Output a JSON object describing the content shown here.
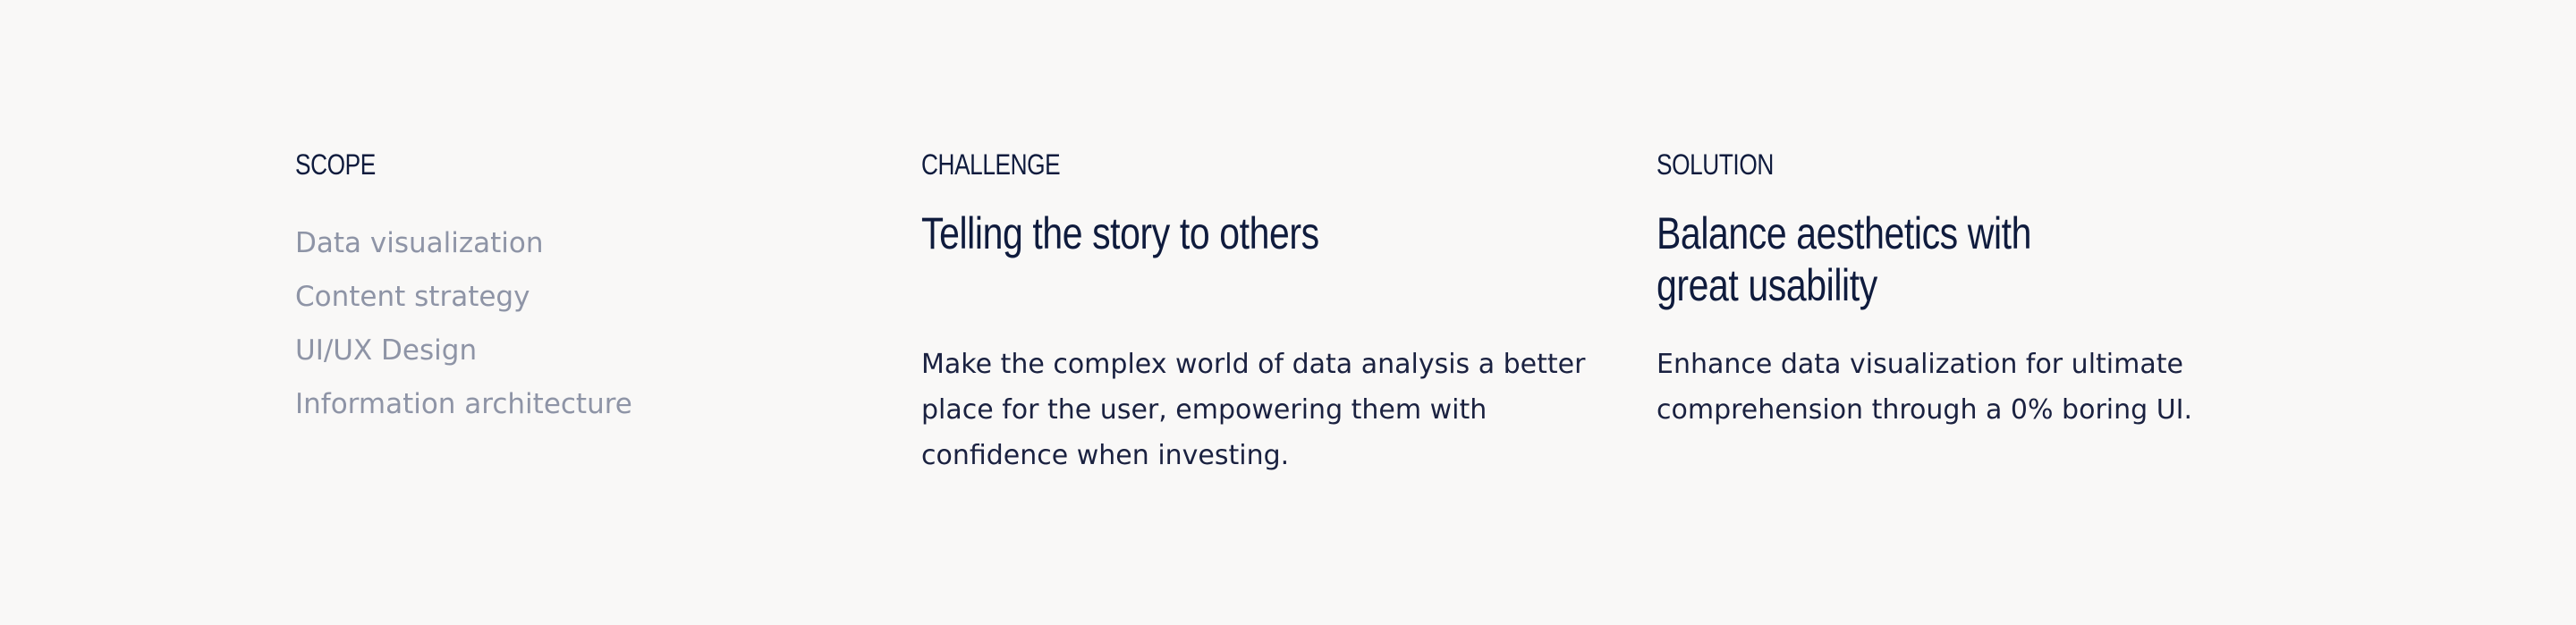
{
  "scope": {
    "label": "SCOPE",
    "items": [
      "Data visualization",
      "Content strategy",
      "UI/UX Design",
      "Information architecture"
    ]
  },
  "challenge": {
    "label": "CHALLENGE",
    "headline_lines": [
      "Telling the story to others"
    ],
    "body_lines": [
      "Make the complex world of data analysis a better",
      "place for the user, empowering them with",
      "confidence when investing."
    ]
  },
  "solution": {
    "label": "SOLUTION",
    "headline_lines": [
      "Balance aesthetics with",
      "great usability"
    ],
    "body_lines": [
      "Enhance data visualization for ultimate",
      "comprehension through a 0% boring UI."
    ]
  },
  "colors": {
    "background": "#f9f8f7",
    "heading": "#0f1b3d",
    "body": "#1a2140",
    "muted": "#8e94a6"
  }
}
